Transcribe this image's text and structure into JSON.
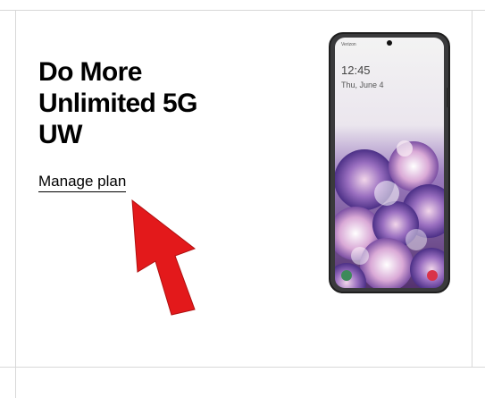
{
  "plan_card": {
    "title": "Do More Unlimited 5G UW",
    "manage_link_label": "Manage plan"
  },
  "phone": {
    "carrier": "Verizon",
    "time": "12:45",
    "date": "Thu, June 4"
  },
  "colors": {
    "arrow": "#e3191b",
    "divider": "#d8d8d8"
  }
}
